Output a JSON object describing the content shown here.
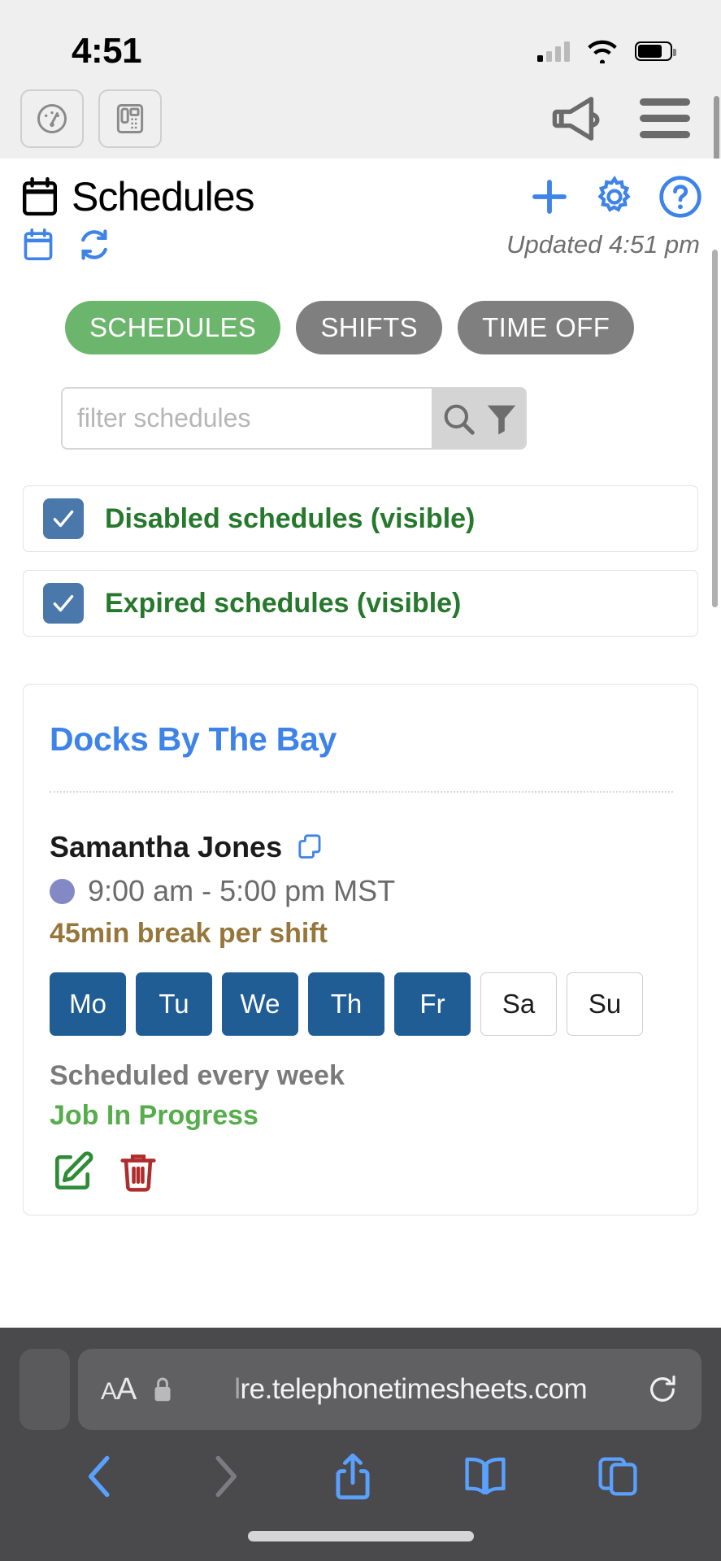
{
  "status_bar": {
    "time": "4:51",
    "signal_icon": "cellular-signal-icon",
    "wifi_icon": "wifi-icon",
    "battery_icon": "battery-icon"
  },
  "app_bar": {
    "dashboard_icon": "gauge-icon",
    "phone_icon": "desk-phone-icon",
    "announcement_icon": "megaphone-icon",
    "menu_icon": "hamburger-menu-icon"
  },
  "header": {
    "title": "Schedules",
    "calendar_icon": "calendar-icon",
    "add_icon": "plus-icon",
    "settings_icon": "gear-icon",
    "help_icon": "question-circle-icon"
  },
  "subheader": {
    "calendar_view_icon": "calendar-small-icon",
    "refresh_icon": "refresh-sync-icon",
    "updated_text": "Updated 4:51 pm"
  },
  "tabs": [
    {
      "label": "SCHEDULES",
      "state": "active"
    },
    {
      "label": "SHIFTS",
      "state": "inactive"
    },
    {
      "label": "TIME OFF",
      "state": "inactive"
    }
  ],
  "search": {
    "placeholder": "filter schedules",
    "value": "",
    "search_icon": "magnifier-icon",
    "filter_icon": "funnel-filter-icon"
  },
  "filters": [
    {
      "label": "Disabled schedules (visible)",
      "checked": true
    },
    {
      "label": "Expired schedules (visible)",
      "checked": true
    }
  ],
  "schedule_card": {
    "title": "Docks By The Bay",
    "employee_name": "Samantha Jones",
    "copy_icon": "copy-duplicate-icon",
    "shift_time": "9:00 am - 5:00 pm MST",
    "break_text": "45min break per shift",
    "days": [
      {
        "label": "Mo",
        "selected": true
      },
      {
        "label": "Tu",
        "selected": true
      },
      {
        "label": "We",
        "selected": true
      },
      {
        "label": "Th",
        "selected": true
      },
      {
        "label": "Fr",
        "selected": true
      },
      {
        "label": "Sa",
        "selected": false
      },
      {
        "label": "Su",
        "selected": false
      }
    ],
    "recurrence": "Scheduled every week",
    "job_status": "Job In Progress",
    "edit_icon": "edit-pencil-icon",
    "delete_icon": "trash-delete-icon"
  },
  "browser": {
    "text_size_label": "AA",
    "lock_icon": "lock-icon",
    "url_prefix": "l",
    "url": "re.telephonetimesheets.com",
    "reload_icon": "reload-icon",
    "back_icon": "back-chevron-icon",
    "forward_icon": "forward-chevron-icon",
    "share_icon": "share-icon",
    "bookmarks_icon": "book-bookmarks-icon",
    "tabs_icon": "tabs-icon"
  },
  "colors": {
    "accent_blue": "#3d83e8",
    "active_tab_green": "#6cb56c",
    "inactive_tab_gray": "#7f7f7f",
    "checkbox_blue": "#4a78ab",
    "check_label_green": "#26782c",
    "day_on_blue": "#205d95",
    "break_brown": "#96763a",
    "job_status_green": "#57ad4c",
    "delete_red": "#b02c2c",
    "edit_green": "#2e8b36"
  }
}
